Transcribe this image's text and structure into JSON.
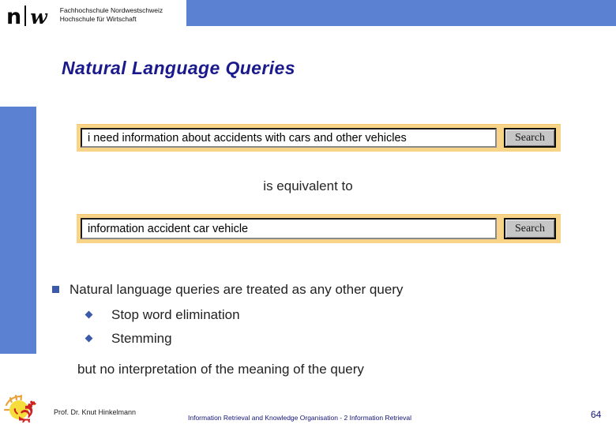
{
  "header": {
    "logo": {
      "mark_left": "n",
      "mark_right": "w",
      "line1": "Fachhochschule Nordwestschweiz",
      "line2": "Hochschule für Wirtschaft"
    },
    "banner_color": "#5b82d2"
  },
  "slide": {
    "title": "Natural Language Queries",
    "title_color": "#1a1a8c",
    "accent_band_color": "#5b82d2"
  },
  "search_examples": [
    {
      "query": "i need information about accidents with cars and other vehicles",
      "button_label": "Search",
      "frame_color": "#f7d488"
    },
    {
      "query": "information accident car vehicle",
      "button_label": "Search",
      "frame_color": "#f7d488"
    }
  ],
  "equivalence_label": "is equivalent to",
  "bullets": {
    "level1": "Natural language queries are treated as any other query",
    "level2": [
      "Stop word elimination",
      "Stemming"
    ],
    "bullet_color": "#3b5ba8"
  },
  "closing_note": "but no interpretation of the meaning of the query",
  "footer": {
    "author": "Prof. Dr. Knut Hinkelmann",
    "center": "Information Retrieval and Knowledge Organisation - 2 Information Retrieval",
    "page_number": "64",
    "logo_icon": "rooster-sun-icon"
  }
}
